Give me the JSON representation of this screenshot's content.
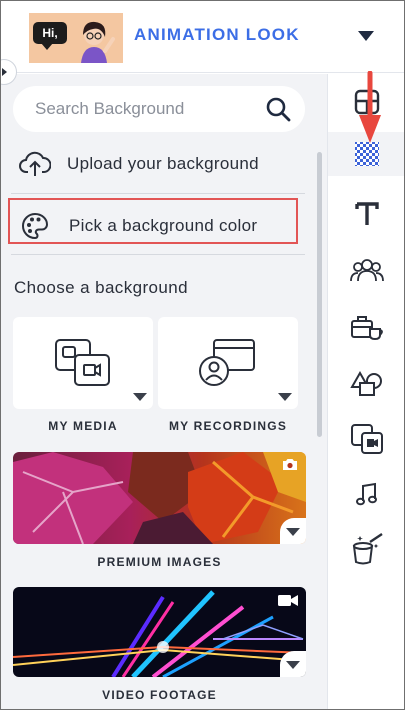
{
  "header": {
    "title": "ANIMATION LOOK",
    "thumbnail_text": "Hi,",
    "colors": {
      "title": "#3c6ee6"
    }
  },
  "search": {
    "placeholder": "Search Background",
    "icon": "search-icon"
  },
  "actions": {
    "upload_label": "Upload your background",
    "pick_color_label": "Pick a background color"
  },
  "section_title": "Choose a background",
  "tiles": [
    {
      "label": "MY MEDIA",
      "icon": "media-icon"
    },
    {
      "label": "MY RECORDINGS",
      "icon": "recordings-icon"
    },
    {
      "label": "PREMIUM IMAGES",
      "icon": "camera-icon"
    },
    {
      "label": "VIDEO FOOTAGE",
      "icon": "video-camera-icon"
    }
  ],
  "toolbar": {
    "items": [
      "layout-icon",
      "background-icon",
      "text-icon",
      "characters-icon",
      "props-icon",
      "shapes-icon",
      "media-icon",
      "music-icon",
      "effects-icon"
    ],
    "active": "background-icon"
  },
  "annotations": {
    "highlight_color": "#e25555"
  }
}
